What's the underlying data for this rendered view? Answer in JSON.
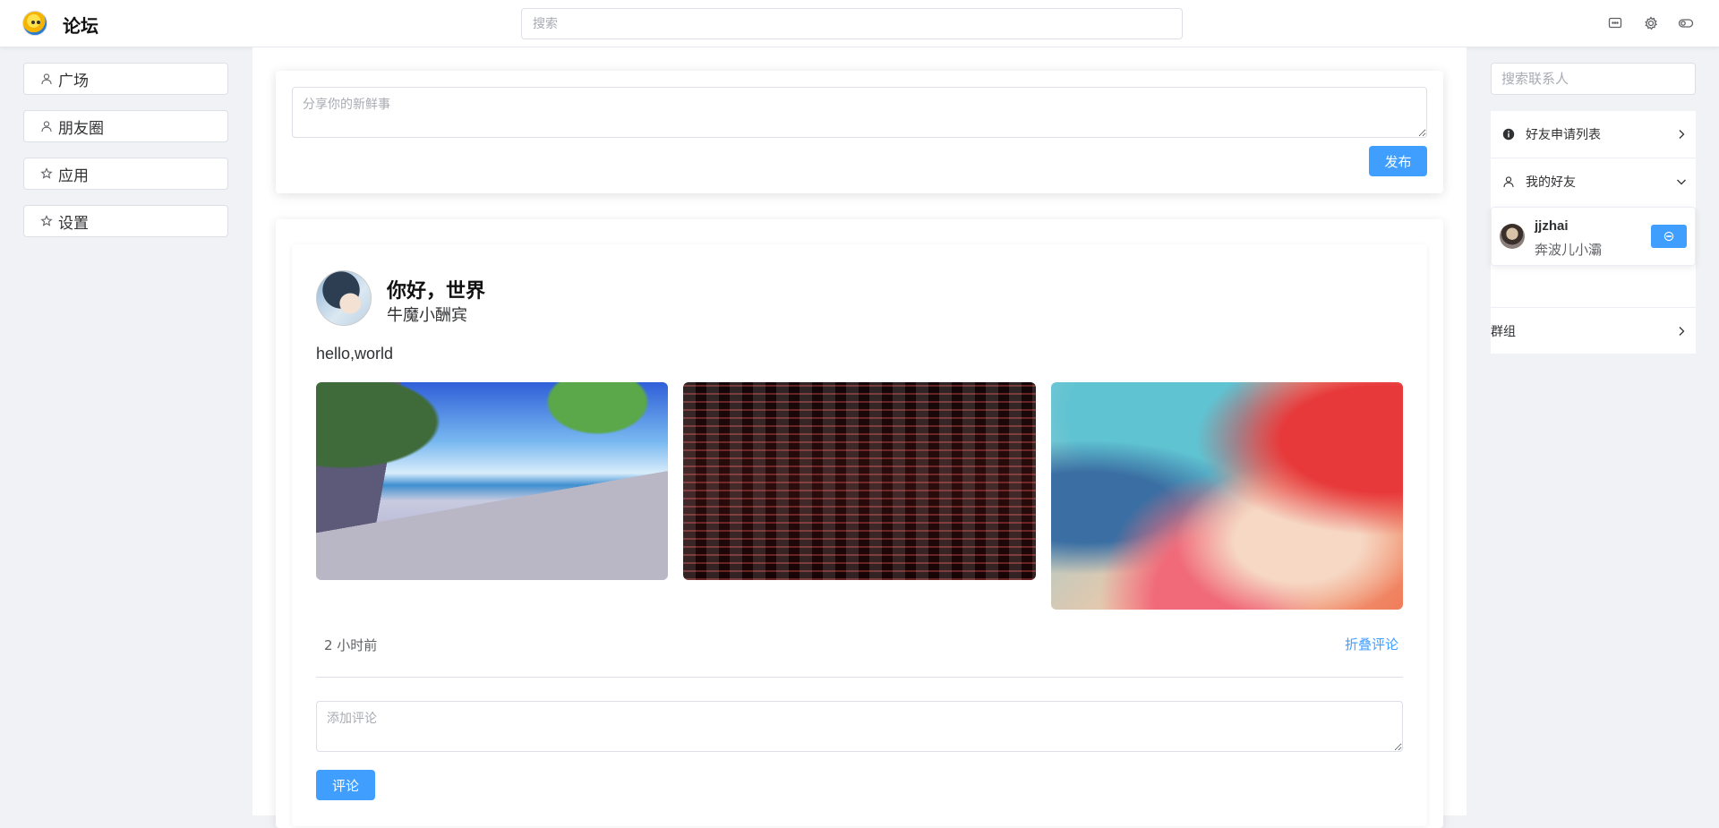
{
  "header": {
    "app_title": "论坛",
    "search_placeholder": "搜索",
    "icons": [
      "chat-icon",
      "gear-icon",
      "toggle-icon"
    ]
  },
  "nav": {
    "items": [
      {
        "label": "广场",
        "icon": "user-icon"
      },
      {
        "label": "朋友圈",
        "icon": "user-icon"
      },
      {
        "label": "应用",
        "icon": "star-icon"
      },
      {
        "label": "设置",
        "icon": "star-icon"
      }
    ]
  },
  "compose": {
    "placeholder": "分享你的新鲜事",
    "publish_label": "发布"
  },
  "post": {
    "title": "你好，世界",
    "author": "牛魔小酬宾",
    "body": "hello,world",
    "images": [
      "image-1",
      "image-2",
      "image-3"
    ],
    "time": "2 小时前",
    "fold_comments_label": "折叠评论",
    "comment_placeholder": "添加评论",
    "comment_button_label": "评论"
  },
  "sidebar_right": {
    "contact_search_placeholder": "搜索联系人",
    "friend_requests_label": "好友申请列表",
    "my_friends_label": "我的好友",
    "friends": [
      {
        "name": "jjzhai",
        "subtitle": "奔波儿小灞"
      }
    ],
    "groups_label": "群组"
  },
  "colors": {
    "primary": "#409eff",
    "background": "#f0f2f5",
    "border": "#dcdfe6"
  }
}
